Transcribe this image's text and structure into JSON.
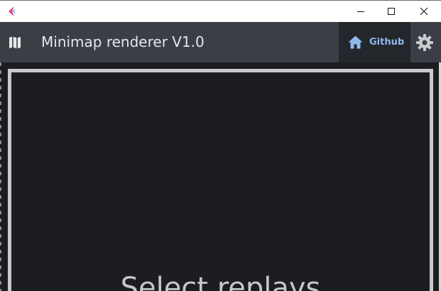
{
  "window": {
    "app_icon": "app-logo-icon",
    "minimize_icon": "minimize-icon",
    "maximize_icon": "maximize-icon",
    "close_icon": "close-icon"
  },
  "header": {
    "icon": "map-icon",
    "title": "Minimap renderer V1.0",
    "github": {
      "icon": "home-icon",
      "label": "Github"
    },
    "settings_icon": "gear-icon"
  },
  "main": {
    "drop_text": "Select replays"
  },
  "colors": {
    "titlebar_bg": "#ffffff",
    "appbar_bg": "#3b3e45",
    "github_bg": "#23262b",
    "github_accent": "#8fb8ec",
    "content_bg": "#1c1d20",
    "dropzone_border": "#c8c9cb"
  }
}
